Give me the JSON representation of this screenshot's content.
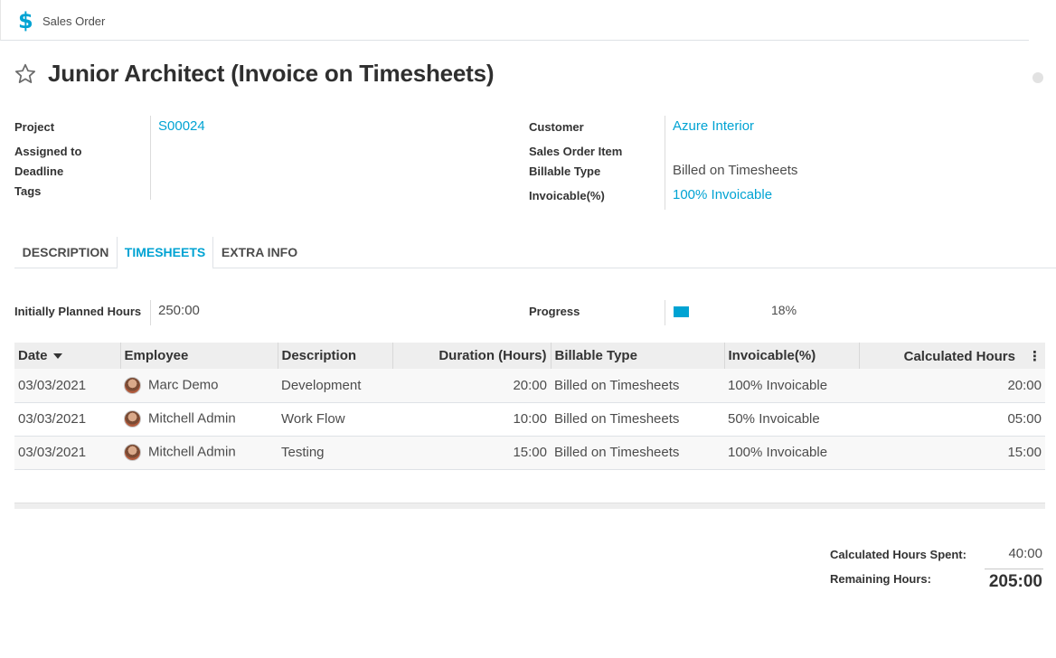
{
  "breadcrumb": {
    "icon": "dollar-icon",
    "label": "Sales Order"
  },
  "record": {
    "title": "Junior Architect (Invoice on Timesheets)",
    "favorite_icon": "star-icon"
  },
  "fields_left": {
    "project_label": "Project",
    "project_value": "S00024",
    "assigned_label": "Assigned to",
    "assigned_value": "",
    "deadline_label": "Deadline",
    "deadline_value": "",
    "tags_label": "Tags",
    "tags_value": ""
  },
  "fields_right": {
    "customer_label": "Customer",
    "customer_value": "Azure Interior",
    "so_item_label": "Sales Order Item",
    "so_item_value": "",
    "billable_label": "Billable Type",
    "billable_value": "Billed on Timesheets",
    "invoicable_label": "Invoicable(%)",
    "invoicable_value": "100% Invoicable"
  },
  "tabs": [
    {
      "label": "DESCRIPTION",
      "active": false
    },
    {
      "label": "TIMESHEETS",
      "active": true
    },
    {
      "label": "EXTRA INFO",
      "active": false
    }
  ],
  "planning": {
    "planned_label": "Initially Planned Hours",
    "planned_value": "250:00",
    "progress_label": "Progress",
    "progress_text": "18%",
    "progress_fraction": 0.18
  },
  "timesheets": {
    "columns": [
      "Date",
      "Employee",
      "Description",
      "Duration (Hours)",
      "Billable Type",
      "Invoicable(%)",
      "Calculated Hours"
    ],
    "rows": [
      {
        "date": "03/03/2021",
        "employee": "Marc Demo",
        "description": "Development",
        "duration": "20:00",
        "billable": "Billed on Timesheets",
        "invoicable": "100% Invoicable",
        "calculated": "20:00"
      },
      {
        "date": "03/03/2021",
        "employee": "Mitchell Admin",
        "description": "Work Flow",
        "duration": "10:00",
        "billable": "Billed on Timesheets",
        "invoicable": "50% Invoicable",
        "calculated": "05:00"
      },
      {
        "date": "03/03/2021",
        "employee": "Mitchell Admin",
        "description": "Testing",
        "duration": "15:00",
        "billable": "Billed on Timesheets",
        "invoicable": "100% Invoicable",
        "calculated": "15:00"
      }
    ]
  },
  "totals": {
    "spent_label": "Calculated Hours Spent:",
    "spent_value": "40:00",
    "remaining_label": "Remaining Hours:",
    "remaining_value": "205:00"
  },
  "colors": {
    "accent": "#00a3d3",
    "text": "#4c4c4c",
    "header_bg": "#eeeeee"
  }
}
